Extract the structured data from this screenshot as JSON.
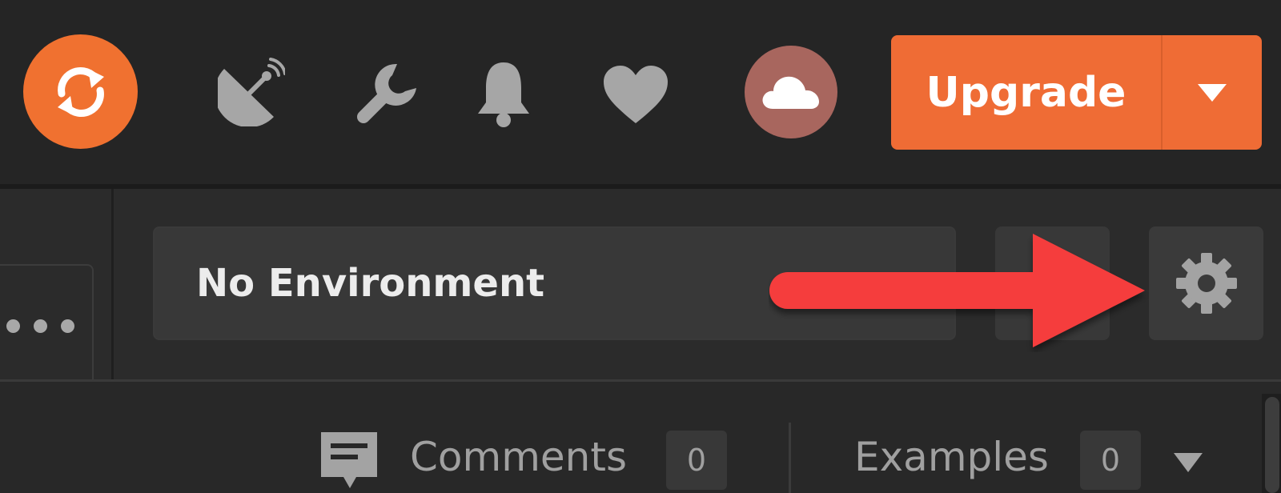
{
  "header": {
    "sync": {
      "icon": "sync-icon"
    },
    "icons": [
      {
        "name": "interceptor-icon"
      },
      {
        "name": "wrench-icon"
      },
      {
        "name": "bell-icon"
      },
      {
        "name": "heart-icon"
      }
    ],
    "avatar": {
      "icon": "cloud-icon",
      "color": "#a8665e"
    },
    "upgrade": {
      "label": "Upgrade",
      "color": "#ef6c35"
    }
  },
  "environment": {
    "selected": "No Environment",
    "quick_look_icon": "eye-icon",
    "settings_icon": "gear-icon",
    "annotation_arrow_color": "#f53d3d"
  },
  "left_tabs": {
    "more_icon": "more-dots-icon"
  },
  "bottom": {
    "comments": {
      "label": "Comments",
      "count": "0"
    },
    "examples": {
      "label": "Examples",
      "count": "0"
    }
  }
}
